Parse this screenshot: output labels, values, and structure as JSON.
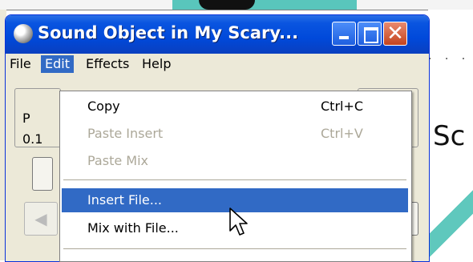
{
  "window": {
    "title": "Sound Object in My Scary...",
    "menu": [
      "File",
      "Edit",
      "Effects",
      "Help"
    ],
    "active_menu": "Edit"
  },
  "underlying": {
    "panel_label_1": "P",
    "panel_label_2": "0.1"
  },
  "edit_menu": {
    "items": [
      {
        "label": "Copy",
        "shortcut": "Ctrl+C",
        "enabled": true
      },
      {
        "label": "Paste Insert",
        "shortcut": "Ctrl+V",
        "enabled": false
      },
      {
        "label": "Paste Mix",
        "shortcut": "",
        "enabled": false
      },
      {
        "label": "Insert File...",
        "shortcut": "",
        "enabled": true,
        "highlighted": true
      },
      {
        "label": "Mix with File...",
        "shortcut": "",
        "enabled": true
      }
    ]
  },
  "background_doc": {
    "ruler": "· · ·",
    "text": "Sc"
  },
  "colors": {
    "titlebar": "#0a55e0",
    "highlight": "#316ac5",
    "disabled_text": "#aca899",
    "close_button": "#c4441f"
  },
  "icons": [
    "sound-recorder-icon",
    "minimize-icon",
    "maximize-icon",
    "close-icon",
    "mouse-pointer-icon"
  ]
}
